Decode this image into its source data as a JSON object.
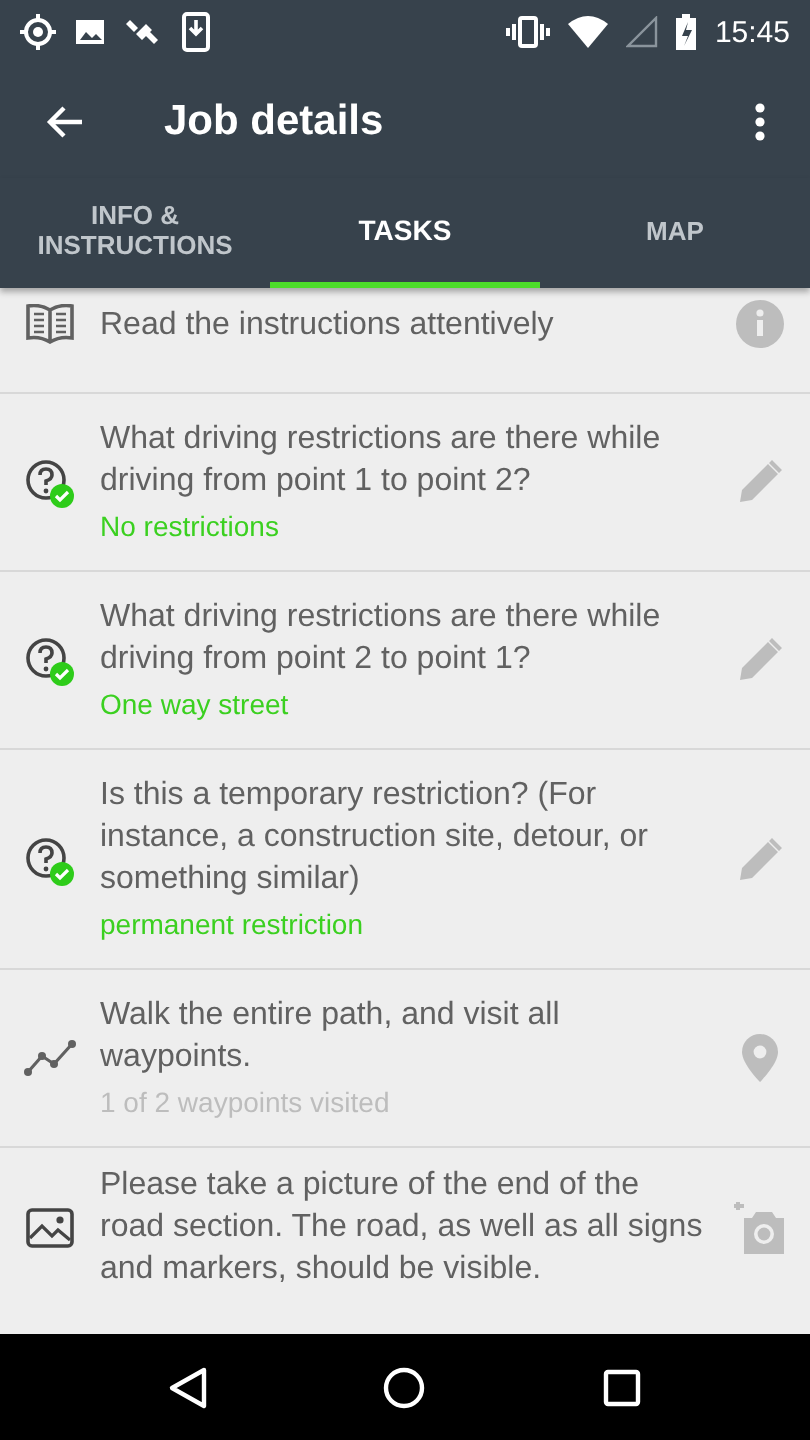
{
  "status_bar": {
    "time": "15:45"
  },
  "toolbar": {
    "title": "Job details"
  },
  "tabs": [
    {
      "label": "INFO &\nINSTRUCTIONS",
      "selected": false
    },
    {
      "label": "TASKS",
      "selected": true
    },
    {
      "label": "MAP",
      "selected": false
    }
  ],
  "tasks": [
    {
      "kind": "info",
      "text": "Read the instructions attentively"
    },
    {
      "kind": "question",
      "text": "What driving restrictions are there while driving from point 1 to point 2?",
      "answered": true,
      "result": "No restrictions",
      "done": true
    },
    {
      "kind": "question",
      "text": "What driving restrictions are there while driving from point 2 to point 1?",
      "answered": true,
      "result": "One way street",
      "done": true
    },
    {
      "kind": "question",
      "text": "Is this a temporary restriction? (For instance, a construction site, detour, or something similar)",
      "answered": true,
      "result": "permanent restriction",
      "done": true
    },
    {
      "kind": "path",
      "text": "Walk the entire path, and visit all waypoints.",
      "result": "1 of 2 waypoints visited",
      "done": false
    },
    {
      "kind": "photo",
      "text": "Please take a picture of the end of the road section. The road, as well as all signs and markers, should be visible."
    }
  ]
}
